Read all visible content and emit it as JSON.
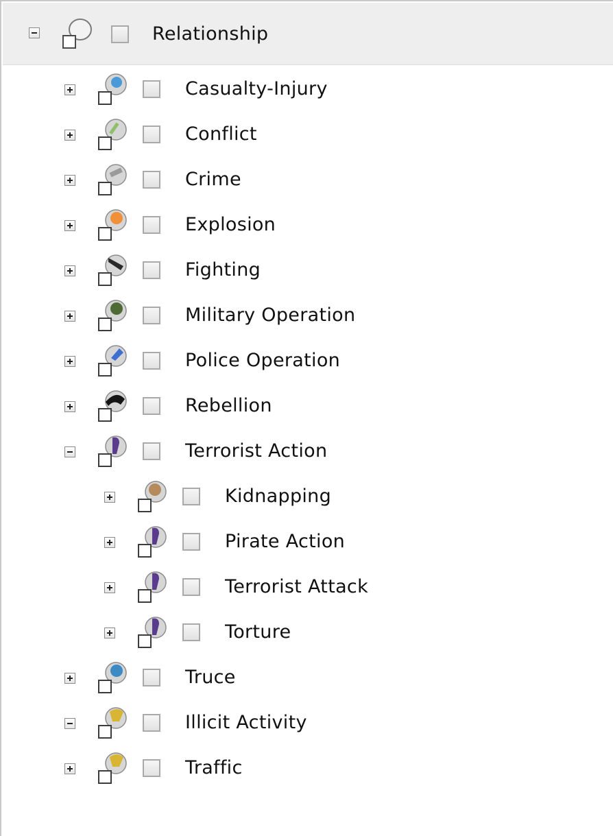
{
  "tree": {
    "root": {
      "label": "Relationship",
      "expanded": true,
      "checked": false,
      "icon": "relationship-bubble-icon"
    },
    "items": [
      {
        "label": "Casualty-Injury",
        "expanded": false,
        "checked": false,
        "icon": "casualty-icon",
        "level": 1,
        "badge_color": "#4a9ad8"
      },
      {
        "label": "Conflict",
        "expanded": false,
        "checked": false,
        "icon": "conflict-icon",
        "level": 1,
        "badge_color": "#8fbf6a"
      },
      {
        "label": "Crime",
        "expanded": false,
        "checked": false,
        "icon": "crime-icon",
        "level": 1,
        "badge_color": "#9a9a9a"
      },
      {
        "label": "Explosion",
        "expanded": false,
        "checked": false,
        "icon": "explosion-icon",
        "level": 1,
        "badge_color": "#f0913a"
      },
      {
        "label": "Fighting",
        "expanded": false,
        "checked": false,
        "icon": "fighting-icon",
        "level": 1,
        "badge_color": "#2a2a2a"
      },
      {
        "label": "Military Operation",
        "expanded": false,
        "checked": false,
        "icon": "military-icon",
        "level": 1,
        "badge_color": "#4f6b35"
      },
      {
        "label": "Police Operation",
        "expanded": false,
        "checked": false,
        "icon": "police-icon",
        "level": 1,
        "badge_color": "#3f6fd0"
      },
      {
        "label": "Rebellion",
        "expanded": false,
        "checked": false,
        "icon": "rebellion-icon",
        "level": 1,
        "badge_color": "#151515"
      },
      {
        "label": "Terrorist Action",
        "expanded": true,
        "checked": false,
        "icon": "terrorist-icon",
        "level": 1,
        "badge_color": "#5b3c8c"
      },
      {
        "label": "Kidnapping",
        "expanded": false,
        "checked": false,
        "icon": "kidnapping-icon",
        "level": 2,
        "badge_color": "#b58a5c"
      },
      {
        "label": "Pirate Action",
        "expanded": false,
        "checked": false,
        "icon": "pirate-icon",
        "level": 2,
        "badge_color": "#5b3c8c"
      },
      {
        "label": "Terrorist Attack",
        "expanded": false,
        "checked": false,
        "icon": "terrorist-attack-icon",
        "level": 2,
        "badge_color": "#5b3c8c"
      },
      {
        "label": "Torture",
        "expanded": false,
        "checked": false,
        "icon": "torture-icon",
        "level": 2,
        "badge_color": "#5b3c8c"
      },
      {
        "label": "Truce",
        "expanded": false,
        "checked": false,
        "icon": "truce-icon",
        "level": 1,
        "badge_color": "#3d8ac4"
      },
      {
        "label": "Illicit Activity",
        "expanded": true,
        "checked": false,
        "icon": "illicit-icon",
        "level": 1,
        "badge_color": "#d8b634"
      },
      {
        "label": "Traffic",
        "expanded": false,
        "checked": false,
        "icon": "traffic-icon",
        "level": 1,
        "badge_color": "#d8b634"
      }
    ]
  }
}
